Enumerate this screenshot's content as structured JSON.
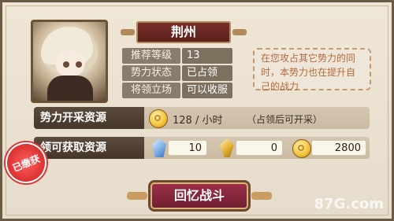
{
  "city": {
    "name": "荆州"
  },
  "info": [
    {
      "label": "推荐等级",
      "value": "13"
    },
    {
      "label": "势力状态",
      "value": "已占领"
    },
    {
      "label": "将领立场",
      "value": "可以收服"
    }
  ],
  "tip": "在您攻占其它势力的同时，本势力也在提升自己的战力",
  "power_resources": {
    "header": "势力开采资源",
    "icon": "gold-coin-icon",
    "rate_text": "128 / 小时",
    "note": "（占领后可开采）"
  },
  "obtainable_resources": {
    "header": "领可获取资源",
    "stamp": "已缴获",
    "items": [
      {
        "icon": "blue-crystal-icon",
        "value": "10"
      },
      {
        "icon": "gold-gem-icon",
        "value": "0"
      },
      {
        "icon": "gold-coin-icon",
        "value": "2800"
      }
    ]
  },
  "actions": {
    "battle_label": "回忆战斗"
  },
  "watermark": "87G.com"
}
